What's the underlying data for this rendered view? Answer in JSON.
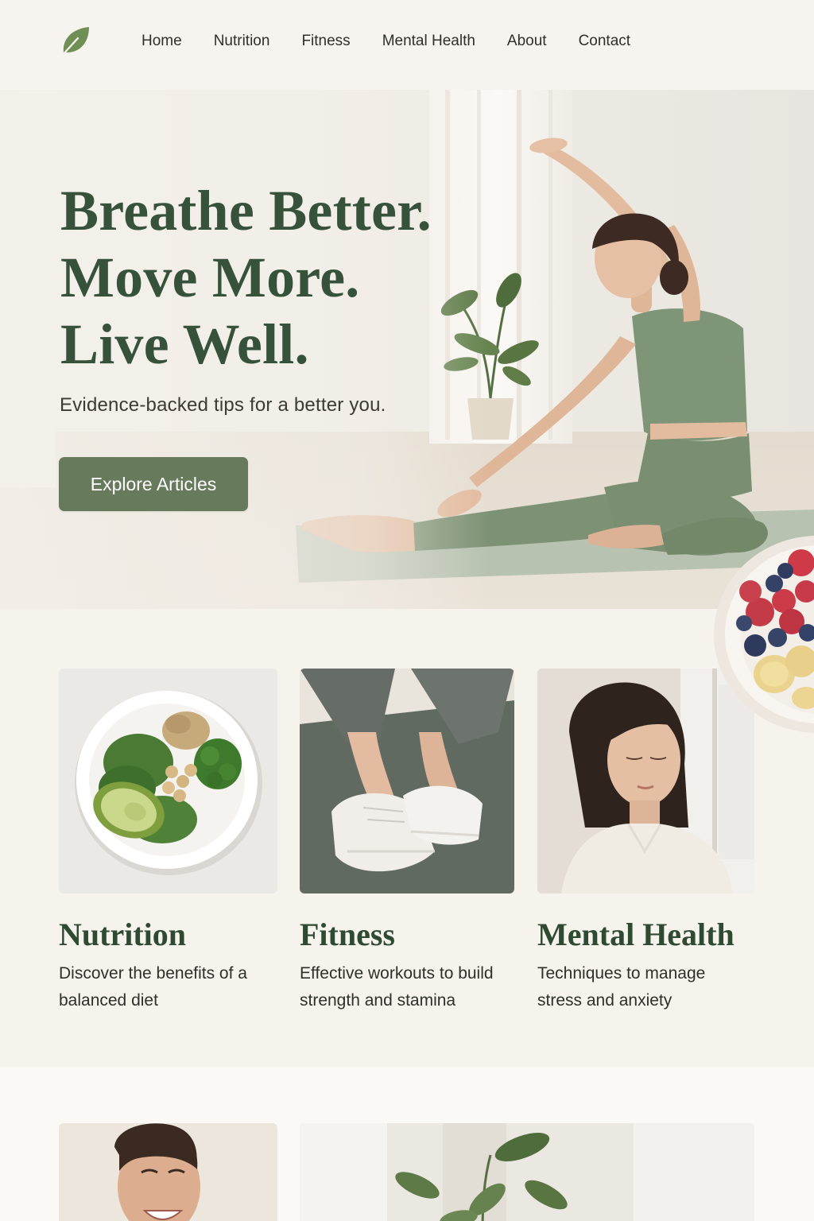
{
  "header": {
    "logo_icon": "leaf-icon",
    "nav": [
      {
        "label": "Home"
      },
      {
        "label": "Nutrition"
      },
      {
        "label": "Fitness"
      },
      {
        "label": "Mental Health"
      },
      {
        "label": "About"
      },
      {
        "label": "Contact"
      }
    ]
  },
  "hero": {
    "title_lines": [
      "Breathe Better.",
      "Move More.",
      "Live Well."
    ],
    "subtitle": "Evidence-backed tips for a better you.",
    "cta_label": "Explore Articles"
  },
  "categories": [
    {
      "title": "Nutrition",
      "description": "Discover the benefits of a balanced diet"
    },
    {
      "title": "Fitness",
      "description": "Effective workouts to build strength and stamina"
    },
    {
      "title": "Mental Health",
      "description": "Techniques to manage stress and anxiety"
    }
  ],
  "colors": {
    "accent": "#687a5c",
    "heading": "#36523a",
    "background": "#f6f2ec"
  }
}
